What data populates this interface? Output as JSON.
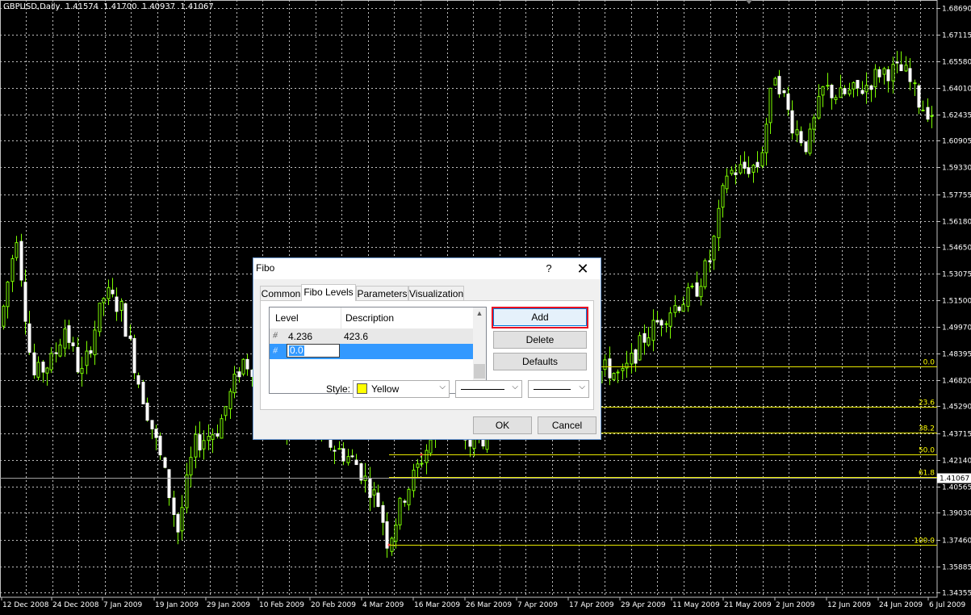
{
  "window": {
    "symbol": "GBPUSD,Daily",
    "open": "1.41574",
    "high": "1.41700",
    "low": "1.40937",
    "close": "1.41067"
  },
  "price_axis": [
    "1.68690",
    "1.67115",
    "1.65580",
    "1.64010",
    "1.62435",
    "1.60905",
    "1.59330",
    "1.57755",
    "1.56180",
    "1.54650",
    "1.53075",
    "1.51500",
    "1.49970",
    "1.48395",
    "1.46820",
    "1.45290",
    "1.43715",
    "1.42140",
    "1.40565",
    "1.39030",
    "1.37460",
    "1.35885",
    "1.34355"
  ],
  "current_price": "1.41067",
  "date_axis": [
    "12 Dec 2008",
    "24 Dec 2008",
    "7 Jan 2009",
    "19 Jan 2009",
    "29 Jan 2009",
    "10 Feb 2009",
    "20 Feb 2009",
    "4 Mar 2009",
    "16 Mar 2009",
    "26 Mar 2009",
    "7 Apr 2009",
    "17 Apr 2009",
    "29 Apr 2009",
    "11 May 2009",
    "21 May 2009",
    "2 Jun 2009",
    "12 Jun 2009",
    "24 Jun 2009",
    "6 Jul 2009"
  ],
  "fibo_levels": [
    {
      "label": "0.0",
      "price": 1.4765
    },
    {
      "label": "23.6",
      "price": 1.4525
    },
    {
      "label": "38.2",
      "price": 1.4375
    },
    {
      "label": "50.0",
      "price": 1.4245
    },
    {
      "label": "61.8",
      "price": 1.4115
    },
    {
      "label": "100.0",
      "price": 1.3715
    }
  ],
  "colors": {
    "bull": "#7CFC00",
    "bear": "#ffffff",
    "grid": "#c0c0c0",
    "fibo": "#e6e600",
    "fibo_label": "#ffff00"
  },
  "dialog": {
    "title": "Fibo",
    "help_icon": "?",
    "close_icon": "✕",
    "tabs": [
      "Common",
      "Fibo Levels",
      "Parameters",
      "Visualization"
    ],
    "active_tab": "Fibo Levels",
    "list": {
      "col_level": "Level",
      "col_description": "Description",
      "rows": [
        {
          "level": "4.236",
          "description": "423.6"
        },
        {
          "level": "0.0",
          "description": ""
        }
      ]
    },
    "add_label": "Add",
    "delete_label": "Delete",
    "defaults_label": "Defaults",
    "style_label": "Style:",
    "color_value": "Yellow",
    "ok_label": "OK",
    "cancel_label": "Cancel"
  }
}
